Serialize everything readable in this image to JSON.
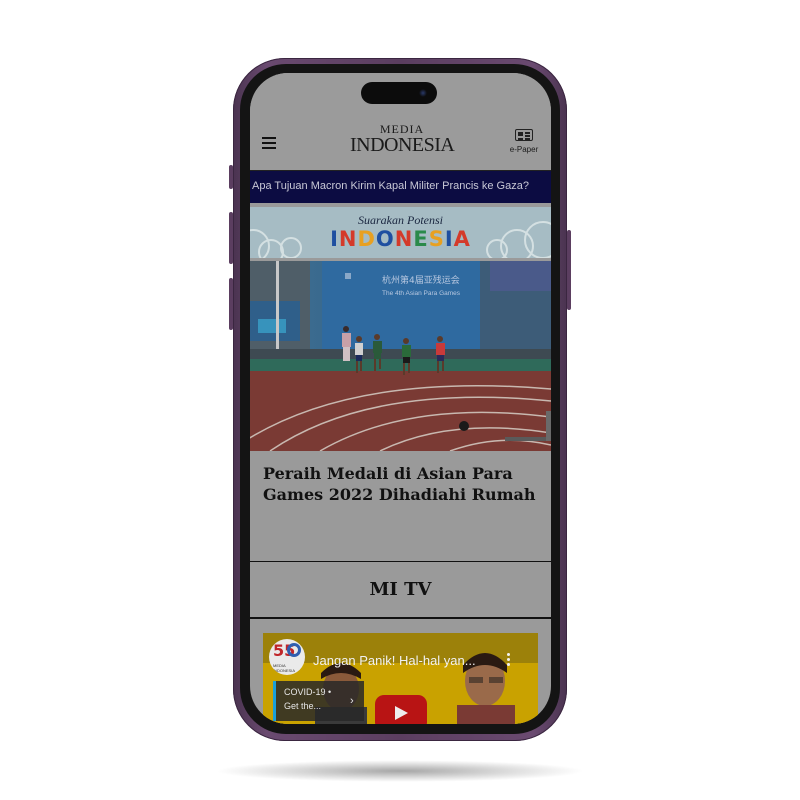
{
  "app": {
    "brand_line1": "MEDIA",
    "brand_line2": "INDONESIA",
    "menu_icon": "hamburger-menu-icon",
    "epaper_icon": "newspaper-icon",
    "epaper_label": "e-Paper"
  },
  "ticker": {
    "text": "Apa Tujuan Macron Kirim Kapal Militer Prancis ke Gaza?"
  },
  "banner": {
    "subtitle": "Suarakan Potensi",
    "title": "INDONESIA",
    "title_colors": [
      "#1f4fa0",
      "#d43a2a",
      "#e8a020",
      "#1f4fa0",
      "#d43a2a",
      "#2a8a4a",
      "#e8a020",
      "#1f4fa0",
      "#d43a2a"
    ]
  },
  "photo": {
    "sign_cn": "杭州第4届亚残运会",
    "sign_en": "The 4th Asian Para Games"
  },
  "article": {
    "headline": "Peraih Medali di Asian Para Games 2022 Dihadiahi Rumah"
  },
  "section": {
    "title": "MI TV"
  },
  "video": {
    "title": "Jangan Panik! Hal-hal yan...",
    "channel_badge": "55",
    "channel_small": "MEDIA INDONESIA",
    "card_line1": "COVID-19 •",
    "card_line2": "Get the...",
    "card_arrow": "›",
    "play_icon": "youtube-play-icon",
    "more_icon": "more-vertical-icon"
  }
}
